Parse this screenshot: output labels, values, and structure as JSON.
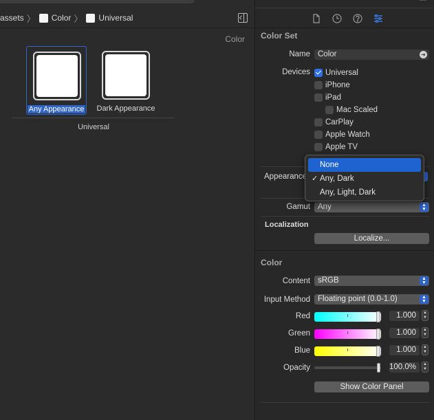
{
  "breadcrumb": [
    {
      "label": "assets",
      "has_icon": false
    },
    {
      "label": "Color",
      "has_icon": true
    },
    {
      "label": "Universal",
      "has_icon": true
    }
  ],
  "editor": {
    "set_label": "Color",
    "wells": [
      {
        "label": "Any Appearance",
        "selected": true,
        "color": "#ffffff"
      },
      {
        "label": "Dark Appearance",
        "selected": false,
        "color": "#ffffff"
      }
    ],
    "group_label": "Universal"
  },
  "inspector": {
    "tabs": [
      "file-icon",
      "history-icon",
      "help-icon",
      "attributes-icon"
    ],
    "active_tab": "attributes-icon",
    "color_set": {
      "title": "Color Set",
      "name_label": "Name",
      "name_value": "Color",
      "devices_label": "Devices",
      "devices": [
        {
          "label": "Universal",
          "checked": true
        },
        {
          "label": "iPhone",
          "checked": false
        },
        {
          "label": "iPad",
          "checked": false
        },
        {
          "label": "Mac Scaled",
          "checked": false
        },
        {
          "label": "CarPlay",
          "checked": false
        },
        {
          "label": "Apple Watch",
          "checked": false
        },
        {
          "label": "Apple TV",
          "checked": false
        }
      ],
      "appearance_label": "Appearances",
      "appearance_label_visible": "Appearance",
      "gamut_label": "Gamut",
      "gamut_value": "Any"
    },
    "appearance_menu": [
      {
        "label": "None",
        "highlighted": true,
        "checked": false
      },
      {
        "label": "Any, Dark",
        "highlighted": false,
        "checked": true
      },
      {
        "label": "Any, Light, Dark",
        "highlighted": false,
        "checked": false
      }
    ],
    "localization": {
      "title": "Localization",
      "button": "Localize..."
    },
    "color": {
      "title": "Color",
      "content_label": "Content",
      "content_value": "sRGB",
      "input_method_label": "Input Method",
      "input_method_value": "Floating point (0.0-1.0)",
      "red_label": "Red",
      "red_value": "1.000",
      "green_label": "Green",
      "green_value": "1.000",
      "blue_label": "Blue",
      "blue_value": "1.000",
      "opacity_label": "Opacity",
      "opacity_value": "100.0%",
      "show_panel_button": "Show Color Panel"
    }
  },
  "colors": {
    "accent": "#2f72e6",
    "selection": "#2f64c8",
    "menu_highlight": "#1f63d1"
  }
}
